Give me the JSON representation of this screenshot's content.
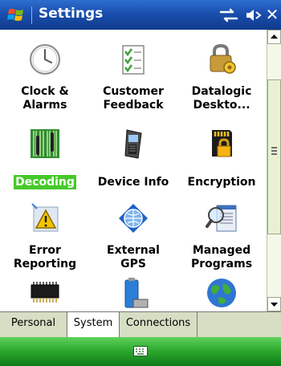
{
  "titlebar": {
    "title": "Settings"
  },
  "items": [
    {
      "name": "clock-alarms",
      "line1": "Clock &",
      "line2": "Alarms",
      "icon": "clock-icon"
    },
    {
      "name": "customer-feedback",
      "line1": "Customer",
      "line2": "Feedback",
      "icon": "clipboard-check-icon"
    },
    {
      "name": "datalogic-desktop",
      "line1": "Datalogic",
      "line2": "Deskto...",
      "icon": "lock-gear-icon"
    },
    {
      "name": "decoding",
      "line1": "Decoding",
      "icon": "barcode-icon",
      "selected": true
    },
    {
      "name": "device-info",
      "line1": "Device Info",
      "icon": "handheld-device-icon"
    },
    {
      "name": "encryption",
      "line1": "Encryption",
      "icon": "sd-card-lock-icon"
    },
    {
      "name": "error-reporting",
      "line1": "Error",
      "line2": "Reporting",
      "icon": "warning-icon"
    },
    {
      "name": "external-gps",
      "line1": "External",
      "line2": "GPS",
      "icon": "gps-globe-icon"
    },
    {
      "name": "managed-programs",
      "line1": "Managed",
      "line2": "Programs",
      "icon": "magnifier-window-icon"
    },
    {
      "name": "memory",
      "icon": "memory-chip-icon"
    },
    {
      "name": "power",
      "icon": "battery-icon"
    },
    {
      "name": "regional-settings",
      "icon": "earth-globe-icon"
    }
  ],
  "tabs": [
    {
      "label": "Personal"
    },
    {
      "label": "System",
      "active": true
    },
    {
      "label": "Connections"
    }
  ],
  "colors": {
    "titlebar": "#1a4fae",
    "selection": "#46c92a",
    "menubar": "#2aa52c",
    "tabbar": "#d6dec4"
  }
}
